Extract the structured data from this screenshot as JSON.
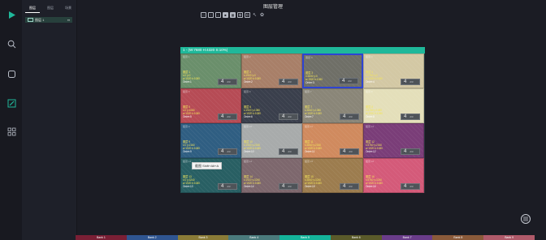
{
  "app": {
    "title": "图层管理"
  },
  "rail": {
    "icons": [
      "play-icon",
      "search-icon",
      "rect-icon",
      "edit-icon",
      "grid-icon"
    ]
  },
  "panel": {
    "tabs": [
      {
        "label": "图层"
      },
      {
        "label": "图层"
      },
      {
        "label": "场景"
      }
    ],
    "layer": {
      "name": "图层 1",
      "eye": "▪▪"
    }
  },
  "toolbar": {
    "buttons": [
      {
        "label": "□"
      },
      {
        "label": "↑"
      },
      {
        "label": "↓"
      },
      {
        "label": "■"
      },
      {
        "label": "▦"
      },
      {
        "label": "⧉"
      },
      {
        "label": "⧠"
      },
      {
        "label": "↖"
      },
      {
        "label": "✿"
      }
    ]
  },
  "canvas": {
    "header": "1 - (W:7680 H:4320 S:10%)"
  },
  "cells": [
    {
      "name": "图层 1",
      "pos": "x:0 y:0",
      "size": "w:1920 h:1080",
      "order": "Order:1",
      "badge": "4",
      "sub": "2/3",
      "color": "#6a8f6b"
    },
    {
      "name": "图层 2",
      "pos": "x:1920 y:0",
      "size": "w:1920 h:1080",
      "order": "Order:2",
      "badge": "4",
      "sub": "2/3",
      "color": "#a87f68"
    },
    {
      "name": "图层 3",
      "pos": "x:3840 y:0",
      "size": "w:1920 h:1080",
      "order": "Order:3",
      "badge": "4",
      "sub": "2/3",
      "color": "#6f6f67"
    },
    {
      "name": "图层 4",
      "pos": "x:5760 y:0",
      "size": "w:1920 h:1080",
      "order": "Order:4",
      "badge": "4",
      "sub": "2/3",
      "color": "#d3c8a4"
    },
    {
      "name": "图层 5",
      "pos": "x:0 y:1080",
      "size": "w:1920 h:1080",
      "order": "Order:5",
      "badge": "4",
      "sub": "2/3",
      "color": "#b64b55"
    },
    {
      "name": "图层 6",
      "pos": "x:1920 y:1080",
      "size": "w:1920 h:1080",
      "order": "Order:6",
      "badge": "4",
      "sub": "2/3",
      "color": "#3a3f4c"
    },
    {
      "name": "图层 7",
      "pos": "x:3840 y:1080",
      "size": "w:1920 h:1080",
      "order": "Order:7",
      "badge": "4",
      "sub": "2/3",
      "color": "#8a8678"
    },
    {
      "name": "图层 8",
      "pos": "x:5760 y:1080",
      "size": "w:1920 h:1080",
      "order": "Order:8",
      "badge": "4",
      "sub": "2/3",
      "color": "#e4dfba"
    },
    {
      "name": "图层 9",
      "pos": "x:0 y:2160",
      "size": "w:1920 h:1080",
      "order": "Order:9",
      "badge": "4",
      "sub": "2/3",
      "color": "#2f5e82"
    },
    {
      "name": "图层 10",
      "pos": "x:1920 y:2160",
      "size": "w:1920 h:1080",
      "order": "Order:10",
      "badge": "4",
      "sub": "2/3",
      "color": "#a8abab"
    },
    {
      "name": "图层 11",
      "pos": "x:3840 y:2160",
      "size": "w:1920 h:1080",
      "order": "Order:11",
      "badge": "4",
      "sub": "2/3",
      "color": "#d08a5e"
    },
    {
      "name": "图层 12",
      "pos": "x:5760 y:2160",
      "size": "w:1920 h:1080",
      "order": "Order:12",
      "badge": "4",
      "sub": "2/3",
      "color": "#7a3d78"
    },
    {
      "name": "图层 13",
      "pos": "x:0 y:3240",
      "size": "w:1920 h:1080",
      "order": "Order:13",
      "badge": "4",
      "sub": "2/3",
      "color": "#285f63"
    },
    {
      "name": "图层 14",
      "pos": "x:1920 y:3240",
      "size": "w:1920 h:1080",
      "order": "Order:14",
      "badge": "4",
      "sub": "2/3",
      "color": "#7d676d"
    },
    {
      "name": "图层 15",
      "pos": "x:3840 y:3240",
      "size": "w:1920 h:1080",
      "order": "Order:15",
      "badge": "4",
      "sub": "2/3",
      "color": "#9c7c4e"
    },
    {
      "name": "图层 16",
      "pos": "x:5760 y:3240",
      "size": "w:1920 h:1080",
      "order": "Order:16",
      "badge": "4",
      "sub": "2/3",
      "color": "#d45a79"
    }
  ],
  "tooltip": {
    "text": "截图 Shift+Alt+A"
  },
  "bottom": {
    "items": [
      {
        "label": "Bank 1",
        "color": "#7a1f35"
      },
      {
        "label": "Bank 2",
        "color": "#2f5591"
      },
      {
        "label": "Bank 3",
        "color": "#8a7b37"
      },
      {
        "label": "Bank 4",
        "color": "#4a7a7c"
      },
      {
        "label": "Bank 5",
        "color": "#14b39a"
      },
      {
        "label": "Bank 6",
        "color": "#5a5a2a"
      },
      {
        "label": "Bank 7",
        "color": "#6a3c8a"
      },
      {
        "label": "Bank 8",
        "color": "#8a5a3a"
      },
      {
        "label": "Bank 9",
        "color": "#b05a6a"
      }
    ]
  }
}
